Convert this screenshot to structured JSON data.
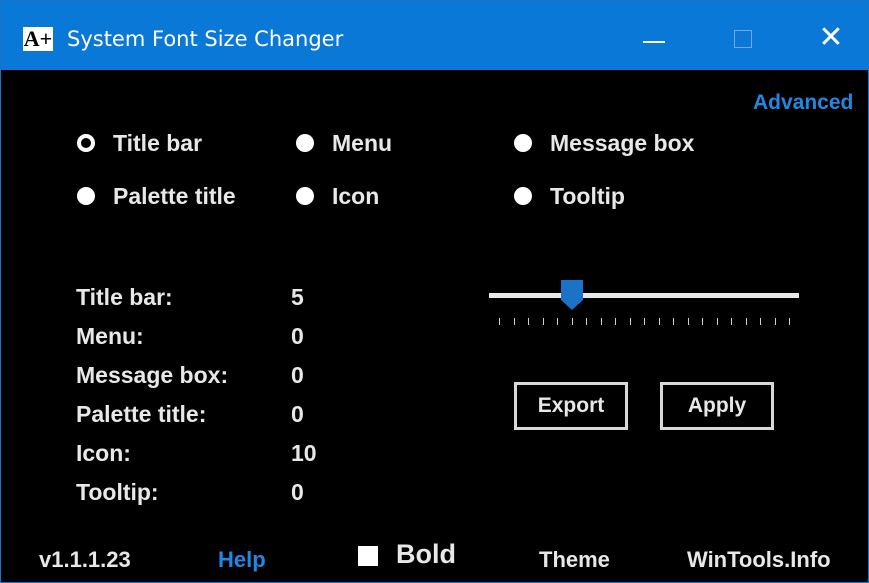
{
  "window": {
    "title": "System Font Size Changer",
    "icon_glyph": "A+",
    "titlebar_color": "#0a78d7",
    "controls": {
      "minimize": "minimize-icon",
      "maximize": "maximize-icon",
      "close": "close-icon",
      "close_glyph": "✕"
    }
  },
  "advanced_link": "Advanced",
  "elements": [
    {
      "label": "Title bar",
      "selected": true
    },
    {
      "label": "Menu",
      "selected": false
    },
    {
      "label": "Message box",
      "selected": false
    },
    {
      "label": "Palette title",
      "selected": false
    },
    {
      "label": "Icon",
      "selected": false
    },
    {
      "label": "Tooltip",
      "selected": false
    }
  ],
  "stats": [
    {
      "label": "Title bar:",
      "value": "5"
    },
    {
      "label": "Menu:",
      "value": "0"
    },
    {
      "label": "Message box:",
      "value": "0"
    },
    {
      "label": "Palette title:",
      "value": "0"
    },
    {
      "label": "Icon:",
      "value": "10"
    },
    {
      "label": "Tooltip:",
      "value": "0"
    }
  ],
  "slider": {
    "value": 5,
    "min": 0,
    "max": 20,
    "thumb_color": "#1a73c7"
  },
  "buttons": {
    "export": "Export",
    "apply": "Apply"
  },
  "footer": {
    "version": "v1.1.1.23",
    "help": "Help",
    "bold_label": "Bold",
    "bold_checked": true,
    "theme": "Theme",
    "site": "WinTools.Info"
  },
  "colors": {
    "accent": "#1f88e5",
    "background": "#000000",
    "text": "#e8e8e8"
  }
}
